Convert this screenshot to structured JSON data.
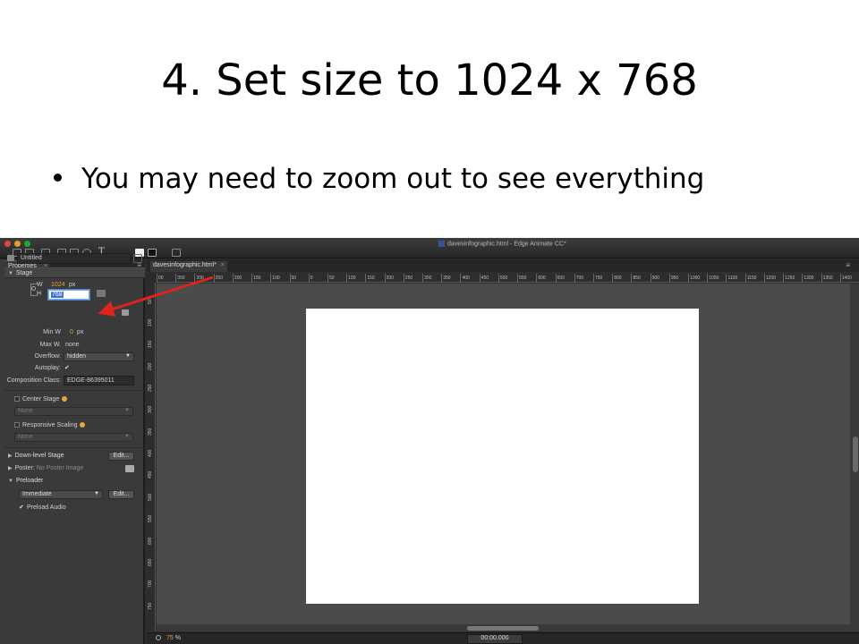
{
  "slide": {
    "title": "4. Set size to 1024 x 768",
    "bullet": "You may need to zoom out to see everything"
  },
  "window": {
    "title": "davesinfographic.html - Edge Animate CC*"
  },
  "toolbar": {
    "text_tool_label": "T"
  },
  "properties_panel": {
    "tab_label": "Properties",
    "tab_close": "×",
    "menu_icon": "≡",
    "symbol_name": "Untitled",
    "stage_section": "Stage",
    "width_label": "W",
    "width_value": "1024",
    "width_unit": "px",
    "height_label": "H",
    "height_value": "768",
    "min_w_label": "Min W",
    "min_w_value": "0",
    "min_w_unit": "px",
    "max_w_label": "Max W.",
    "max_w_value": "none",
    "overflow_label": "Overflow:",
    "overflow_value": "hidden",
    "autoplay_label": "Autoplay:",
    "composition_class_label": "Composition Class:",
    "composition_class_value": "EDGE-86395011",
    "center_stage_label": "Center Stage",
    "center_stage_value": "None",
    "responsive_scaling_label": "Responsive Scaling",
    "responsive_scaling_value": "None",
    "down_level_stage_label": "Down-level Stage",
    "edit_label": "Edit...",
    "poster_label": "Poster:",
    "poster_value": "No Poster Image",
    "preloader_section": "Preloader",
    "preloader_value": "Immediate",
    "preload_audio_label": "Preload Audio"
  },
  "document": {
    "tab_label": "davesinfographic.html*",
    "tab_close": "×",
    "menu_icon": "≡",
    "ruler_h_labels": [
      "00",
      "350",
      "300",
      "250",
      "200",
      "150",
      "100",
      "50",
      "0",
      "50",
      "100",
      "150",
      "200",
      "250",
      "300",
      "350",
      "400",
      "450",
      "500",
      "550",
      "600",
      "650",
      "700",
      "750",
      "800",
      "850",
      "900",
      "950",
      "1000",
      "1050",
      "1100",
      "1150",
      "1200",
      "1250",
      "1300",
      "1350",
      "1400"
    ],
    "ruler_v_labels": [
      "50",
      "100",
      "150",
      "200",
      "250",
      "300",
      "350",
      "400",
      "450",
      "500",
      "550",
      "600",
      "650",
      "700",
      "750"
    ]
  },
  "statusbar": {
    "zoom_value": "75",
    "zoom_unit": "%",
    "time": "00:00.000"
  },
  "colors": {
    "accent_orange": "#e3a63b",
    "arrow_red": "#e0241b",
    "selection_blue": "#3b74d4"
  }
}
